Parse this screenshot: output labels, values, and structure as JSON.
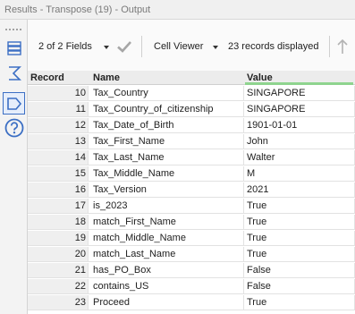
{
  "window": {
    "title": "Results - Transpose (19) - Output"
  },
  "toolbar": {
    "fields_label": "2 of 2 Fields",
    "viewer_label": "Cell Viewer",
    "records_label": "23 records displayed"
  },
  "sidebar": {
    "icons": [
      "table-icon",
      "sigma-icon",
      "tag-icon",
      "help-icon"
    ]
  },
  "colors": {
    "accent": "#3c6fc4",
    "value_header_underline": "#8fd48f"
  },
  "table": {
    "columns": [
      "Record",
      "Name",
      "Value"
    ],
    "rows": [
      {
        "record": "10",
        "name": "Tax_Country",
        "value": "SINGAPORE"
      },
      {
        "record": "11",
        "name": "Tax_Country_of_citizenship",
        "value": "SINGAPORE"
      },
      {
        "record": "12",
        "name": "Tax_Date_of_Birth",
        "value": "1901-01-01"
      },
      {
        "record": "13",
        "name": "Tax_First_Name",
        "value": "John"
      },
      {
        "record": "14",
        "name": "Tax_Last_Name",
        "value": "Walter"
      },
      {
        "record": "15",
        "name": "Tax_Middle_Name",
        "value": "M"
      },
      {
        "record": "16",
        "name": "Tax_Version",
        "value": "2021"
      },
      {
        "record": "17",
        "name": "is_2023",
        "value": "True"
      },
      {
        "record": "18",
        "name": "match_First_Name",
        "value": "True"
      },
      {
        "record": "19",
        "name": "match_Middle_Name",
        "value": "True"
      },
      {
        "record": "20",
        "name": "match_Last_Name",
        "value": "True"
      },
      {
        "record": "21",
        "name": "has_PO_Box",
        "value": "False"
      },
      {
        "record": "22",
        "name": "contains_US",
        "value": "False"
      },
      {
        "record": "23",
        "name": "Proceed",
        "value": "True"
      }
    ]
  }
}
